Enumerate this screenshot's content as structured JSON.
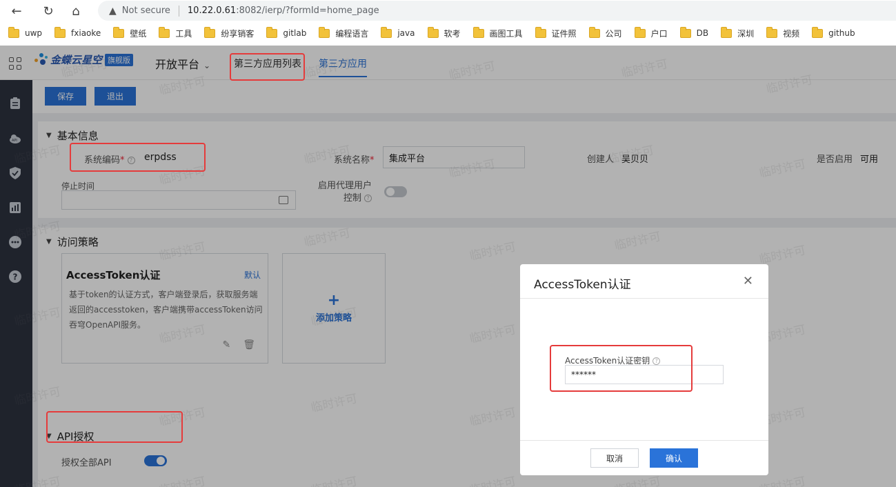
{
  "browser": {
    "security": "Not secure",
    "url_host": "10.22.0.61",
    "url_rest": ":8082/ierp/?formId=home_page",
    "bookmarks": [
      "uwp",
      "fxiaoke",
      "壁纸",
      "工具",
      "纷享销客",
      "gitlab",
      "编程语言",
      "java",
      "软考",
      "画图工具",
      "证件照",
      "公司",
      "户口",
      "DB",
      "深圳",
      "视频",
      "github"
    ]
  },
  "app": {
    "brand": "金蝶云星空",
    "brand_badge": "旗舰版",
    "platform": "开放平台",
    "tabs": [
      "第三方应用列表",
      "第三方应用"
    ],
    "watermark": "临时许可"
  },
  "toolbar": {
    "save": "保存",
    "exit": "退出"
  },
  "basic_info": {
    "title": "基本信息",
    "system_code_label": "系统编码",
    "system_code_value": "erpdss",
    "system_name_label": "系统名称",
    "system_name_value": "集成平台",
    "creator_label": "创建人",
    "creator_value": "吴贝贝",
    "enabled_label": "是否启用",
    "enabled_value": "可用",
    "stop_time_label": "停止时间",
    "proxy_label_line1": "启用代理用户",
    "proxy_label_line2": "控制"
  },
  "access_policy": {
    "title": "访问策略",
    "card_title": "AccessToken认证",
    "card_default": "默认",
    "card_desc": "基于token的认证方式，客户端登录后，获取服务端返回的accesstoken，客户端携带accessToken访问吞穹OpenAPI服务。",
    "add_label": "添加策略"
  },
  "api_auth": {
    "title": "API授权",
    "all_api_label": "授权全部API",
    "all_api_enabled": true
  },
  "modal": {
    "title": "AccessToken认证",
    "field_label": "AccessToken认证密钥",
    "field_value": "******",
    "cancel": "取消",
    "confirm": "确认"
  },
  "colors": {
    "primary": "#2a73d9",
    "highlight": "#e53b3b",
    "sidebar": "#2d3340"
  }
}
